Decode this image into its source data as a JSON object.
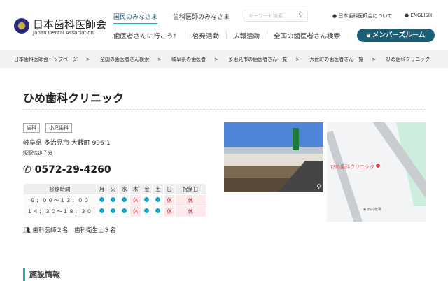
{
  "header": {
    "logo_jp": "日本歯科医師会",
    "logo_en": "Japan Dental Association",
    "nav_top": [
      "国民のみなさま",
      "歯科医師のみなさま"
    ],
    "search_placeholder": "キーワード検索",
    "about": "日本歯科医師会について",
    "english": "ENGLISH",
    "nav_main": [
      "歯医者さんに行こう！",
      "啓発活動",
      "広報活動",
      "全国の歯医者さん検索"
    ],
    "member_button": "メンバーズルーム"
  },
  "breadcrumb": [
    "日本歯科医師会トップページ",
    "全国の歯医者さん検索",
    "岐阜県の歯医者",
    "多治見市の歯医者さん一覧",
    "大薮町の歯医者さん一覧",
    "ひめ歯科クリニック"
  ],
  "clinic": {
    "name": "ひめ歯科クリニック",
    "tags": [
      "歯科",
      "小児歯科"
    ],
    "address": "岐阜県 多治見市 大薮町 996-1",
    "access": "姫駅徒歩７分",
    "phone": "0572-29-4260",
    "hours": {
      "header": [
        "診療時間",
        "月",
        "火",
        "水",
        "木",
        "金",
        "土",
        "日",
        "祝祭日"
      ],
      "rows": [
        {
          "time": "９：００〜１３：００",
          "days": [
            "open",
            "open",
            "open",
            "休",
            "open",
            "open",
            "休",
            "休"
          ]
        },
        {
          "time": "１４：３０〜１８：３０",
          "days": [
            "open",
            "open",
            "open",
            "休",
            "open",
            "open",
            "休",
            "休"
          ]
        }
      ]
    },
    "staff": "歯科医師２名　歯科衛生士３名",
    "map_label": "ひめ歯科クリニック",
    "map_poi": "西村牧場"
  },
  "section": {
    "facility": "施設情報"
  },
  "colors": {
    "brand": "#1b5e75",
    "accent": "#22a0c0",
    "closed_bg": "#fde8ec"
  }
}
